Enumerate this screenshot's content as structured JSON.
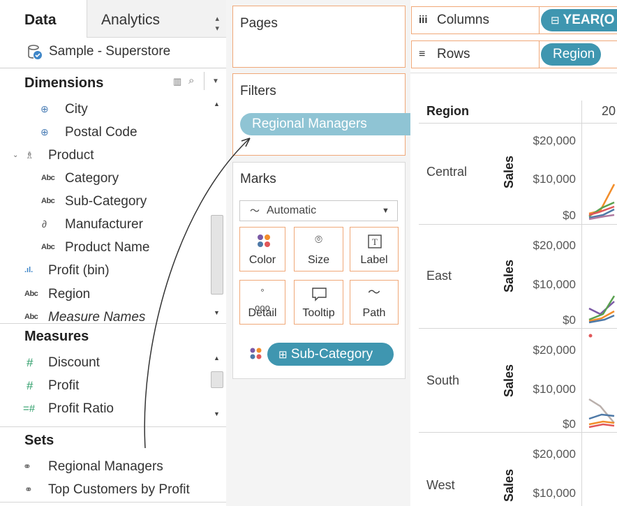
{
  "tabs": {
    "data": "Data",
    "analytics": "Analytics"
  },
  "datasource": {
    "name": "Sample - Superstore"
  },
  "dimensions": {
    "title": "Dimensions",
    "items": [
      {
        "label": "City",
        "icon": "globe-icon"
      },
      {
        "label": "Postal Code",
        "icon": "globe-icon"
      },
      {
        "label": "Product",
        "icon": "hierarchy-icon"
      },
      {
        "label": "Category",
        "icon": "abc-icon"
      },
      {
        "label": "Sub-Category",
        "icon": "abc-icon"
      },
      {
        "label": "Manufacturer",
        "icon": "link-icon"
      },
      {
        "label": "Product Name",
        "icon": "abc-icon"
      },
      {
        "label": "Profit (bin)",
        "icon": "bin-icon"
      },
      {
        "label": "Region",
        "icon": "abc-icon"
      },
      {
        "label": "Measure Names",
        "icon": "abc-icon"
      }
    ]
  },
  "measures": {
    "title": "Measures",
    "items": [
      {
        "label": "Discount",
        "icon": "hash-icon"
      },
      {
        "label": "Profit",
        "icon": "hash-icon"
      },
      {
        "label": "Profit Ratio",
        "icon": "calc-hash-icon"
      }
    ]
  },
  "sets": {
    "title": "Sets",
    "items": [
      {
        "label": "Regional Managers",
        "icon": "set-icon"
      },
      {
        "label": "Top Customers by Profit",
        "icon": "set-icon"
      }
    ]
  },
  "shelves": {
    "pages": "Pages",
    "filters": "Filters",
    "filter_pill": "Regional Managers",
    "marks": "Marks",
    "mark_type": "Automatic",
    "columns": "Columns",
    "columns_pill": "YEAR(O",
    "rows": "Rows",
    "rows_pill": "Region",
    "sub_pill": "Sub-Category"
  },
  "mark_buttons": [
    {
      "label": "Color",
      "icon": "color-icon"
    },
    {
      "label": "Size",
      "icon": "size-icon"
    },
    {
      "label": "Label",
      "icon": "label-icon"
    },
    {
      "label": "Detail",
      "icon": "detail-icon"
    },
    {
      "label": "Tooltip",
      "icon": "tooltip-icon"
    },
    {
      "label": "Path",
      "icon": "path-icon"
    }
  ],
  "view": {
    "region_header": "Region",
    "col_header": "20",
    "axis_label": "Sales",
    "ticks": [
      "$20,000",
      "$10,000",
      "$0"
    ],
    "regions": [
      "Central",
      "East",
      "South",
      "West"
    ]
  },
  "colors": {
    "pill": "#3f96b0",
    "shelf_border": "#f0a878"
  }
}
